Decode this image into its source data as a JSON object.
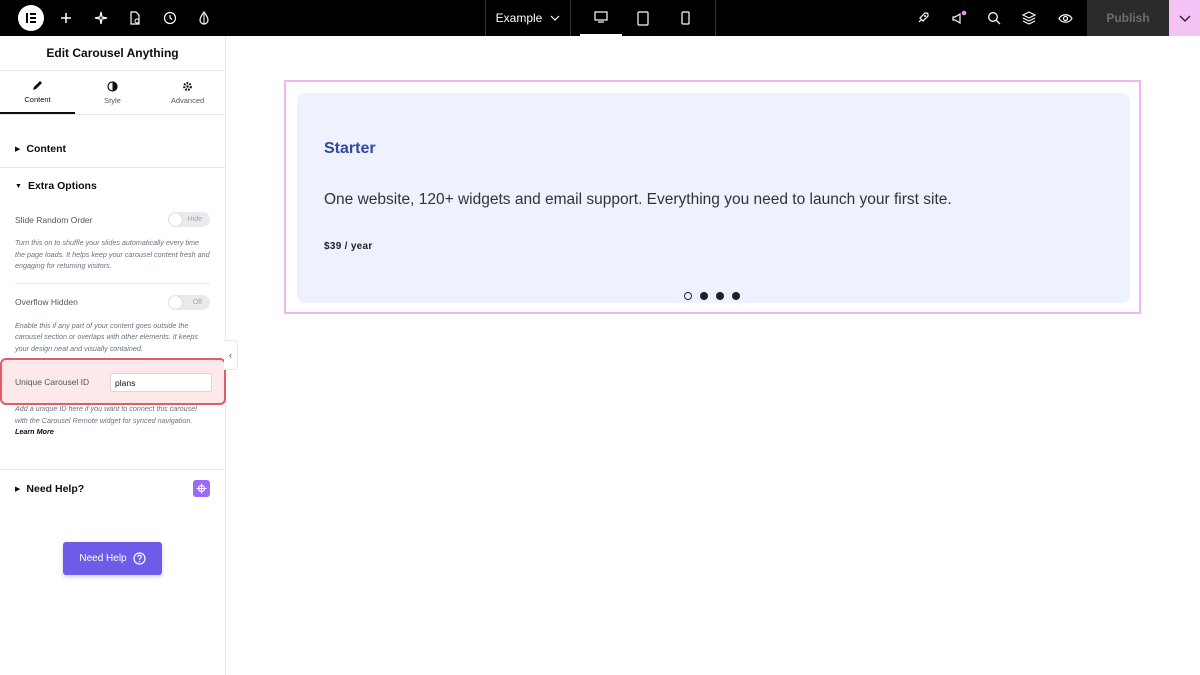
{
  "topbar": {
    "doc_title": "Example",
    "publish_label": "Publish",
    "icons": [
      "elementor-logo-icon",
      "add-icon",
      "ai-sparkle-icon",
      "page-settings-icon",
      "history-icon",
      "theme-style-icon",
      "desktop-icon",
      "tablet-icon",
      "mobile-icon",
      "rocket-icon",
      "announcements-icon",
      "search-icon",
      "structure-layers-icon",
      "preview-eye-icon",
      "chevron-down-icon"
    ]
  },
  "panel": {
    "title": "Edit Carousel Anything",
    "tabs": [
      {
        "label": "Content",
        "icon": "pencil-icon"
      },
      {
        "label": "Style",
        "icon": "half-circle-icon"
      },
      {
        "label": "Advanced",
        "icon": "gear-icon"
      }
    ],
    "sections": {
      "content": "Content",
      "extra_options": "Extra Options",
      "need_help": "Need Help?"
    },
    "controls": {
      "slide_random_order": {
        "label": "Slide Random Order",
        "switch_text": "Hide",
        "description": "Turn this on to shuffle your slides automatically every time the page loads. It helps keep your carousel content fresh and engaging for returning visitors."
      },
      "overflow_hidden": {
        "label": "Overflow Hidden",
        "switch_text": "Off",
        "description": "Enable this if any part of your content goes outside the carousel section or overlaps with other elements. It keeps your design neat and visually contained."
      },
      "unique_id": {
        "label": "Unique Carousel ID",
        "value": "plans",
        "description": "Add a unique ID here if you want to connect this carousel with the Carousel Remote widget for synced navigation.",
        "learn_more": "Learn More"
      }
    },
    "need_help_button": "Need Help"
  },
  "canvas": {
    "card": {
      "title": "Starter",
      "text": "One website, 120+ widgets and email support. Everything you need to launch your first site.",
      "price": "$39 / year"
    },
    "dots": {
      "count": 4,
      "active_index": 0
    }
  },
  "colors": {
    "accent": "#6c5ce7",
    "highlight_border": "#e35a6a",
    "card_bg": "#eef1fe",
    "card_title": "#2f4aa0",
    "frame_border": "#f3b5f0"
  }
}
